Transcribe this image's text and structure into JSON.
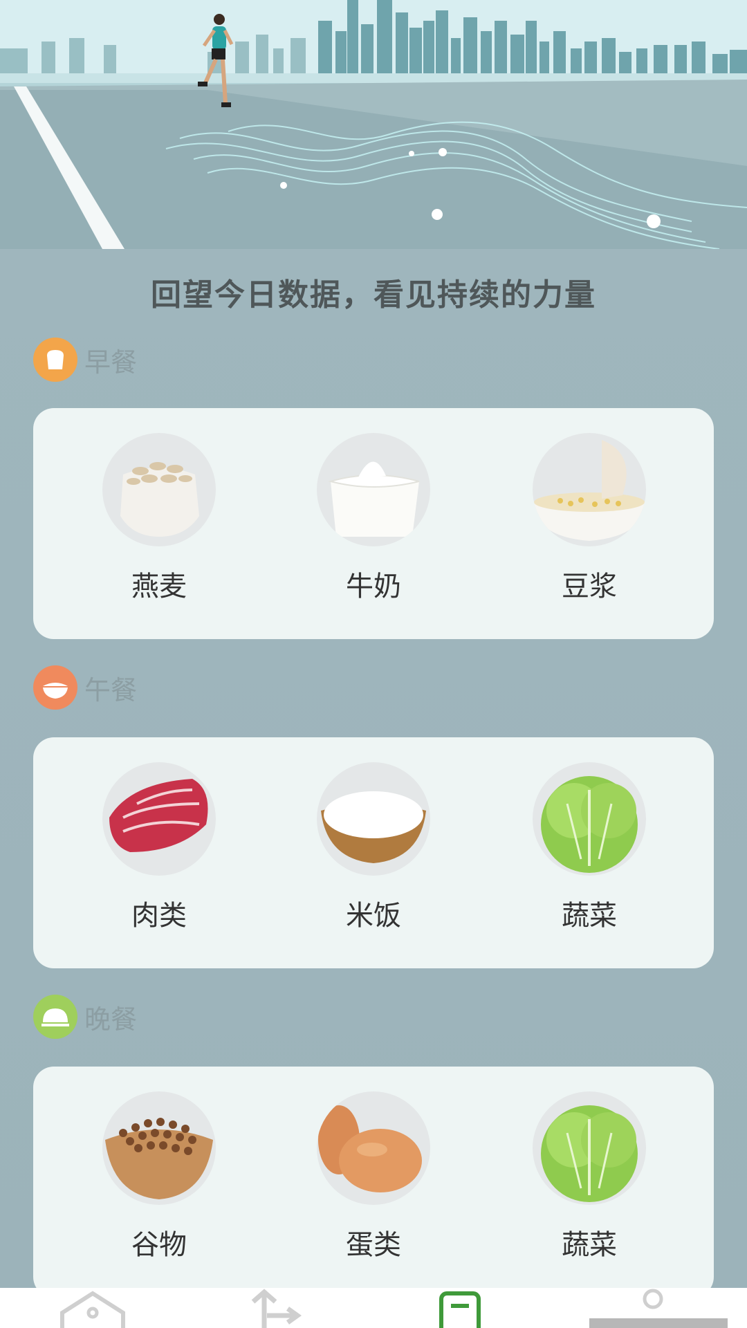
{
  "hero": {
    "image": "runner-city-skyline-illustration"
  },
  "slogan": "回望今日数据，看见持续的力量",
  "meals": [
    {
      "label": "早餐",
      "icon": "toast-icon",
      "icon_color": "#f3a54a",
      "foods": [
        {
          "label": "燕麦",
          "icon": "oats-image"
        },
        {
          "label": "牛奶",
          "icon": "milk-image"
        },
        {
          "label": "豆浆",
          "icon": "soy-milk-image"
        }
      ]
    },
    {
      "label": "午餐",
      "icon": "rice-bowl-icon",
      "icon_color": "#f08a5d",
      "foods": [
        {
          "label": "肉类",
          "icon": "meat-image"
        },
        {
          "label": "米饭",
          "icon": "rice-image"
        },
        {
          "label": "蔬菜",
          "icon": "lettuce-image"
        }
      ]
    },
    {
      "label": "晚餐",
      "icon": "dish-cover-icon",
      "icon_color": "#9fcf5c",
      "foods": [
        {
          "label": "谷物",
          "icon": "grain-image"
        },
        {
          "label": "蛋类",
          "icon": "egg-image"
        },
        {
          "label": "蔬菜",
          "icon": "lettuce-image"
        }
      ]
    }
  ],
  "tabbar": {
    "tabs": [
      {
        "icon": "home-icon",
        "active": false
      },
      {
        "icon": "route-icon",
        "active": false
      },
      {
        "icon": "record-icon",
        "active": true
      },
      {
        "icon": "profile-icon",
        "active": false
      }
    ],
    "active_color": "#3f9a3a"
  }
}
